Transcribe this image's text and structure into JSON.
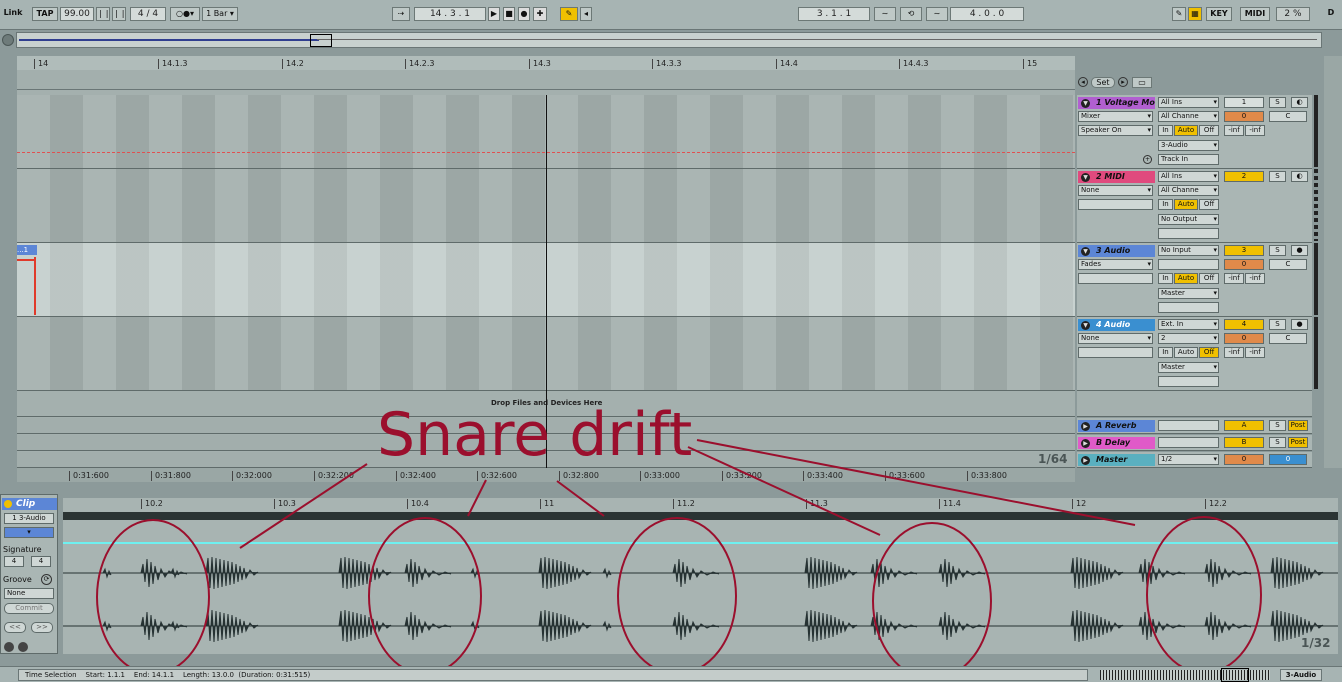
{
  "transport": {
    "link": "Link",
    "tap": "TAP",
    "tempo": "99.00",
    "sig_num": "4",
    "sig_sep": "/",
    "sig_den": "4",
    "quant": "1 Bar",
    "position": "14 . 3 . 1",
    "loop_start": "3 . 1 . 1",
    "loop_len": "4 . 0 . 0",
    "key": "KEY",
    "midi": "MIDI",
    "cpu": "2 %",
    "d": "D"
  },
  "arrangement": {
    "ruler_ticks": [
      "14",
      "14.1.3",
      "14.2",
      "14.2.3",
      "14.3",
      "14.3.3",
      "14.4",
      "14.4.3",
      "15"
    ],
    "time_ticks": [
      "0:31:600",
      "0:31:800",
      "0:32:000",
      "0:32:200",
      "0:32:400",
      "0:32:600",
      "0:32:800",
      "0:33:000",
      "0:33:200",
      "0:33:400",
      "0:33:600",
      "0:33:800"
    ],
    "drop_label": "Drop Files and Devices Here",
    "zoom": "1/64",
    "set_label": "Set",
    "clip_stub": "...1"
  },
  "tracks": [
    {
      "name": "1 Voltage Mo",
      "color": "#b15fd0",
      "input": "All Ins",
      "chan": "All Channe",
      "dev1": "Mixer",
      "dev2": "Speaker On",
      "out": "3-Audio",
      "out2": "Track In",
      "num": "1",
      "vol": "0",
      "pan": "C",
      "in": "In",
      "auto": "Auto",
      "off": "Off",
      "inf1": "-inf",
      "inf2": "-inf",
      "s": "S"
    },
    {
      "name": "2 MIDI",
      "color": "#e04a7e",
      "input": "All Ins",
      "chan": "All Channe",
      "dev1": "None",
      "out": "No Output",
      "num": "2",
      "in": "In",
      "auto": "Auto",
      "off": "Off",
      "s": "S"
    },
    {
      "name": "3 Audio",
      "color": "#5c86d6",
      "input": "No Input",
      "dev1": "Fades",
      "out": "Master",
      "num": "3",
      "vol": "0",
      "pan": "C",
      "in": "In",
      "auto": "Auto",
      "off": "Off",
      "inf1": "-inf",
      "inf2": "-inf",
      "s": "S"
    },
    {
      "name": "4 Audio",
      "color": "#3a8fd0",
      "input": "Ext. In",
      "chan": "2",
      "dev1": "None",
      "out": "Master",
      "num": "4",
      "vol": "0",
      "pan": "C",
      "in": "In",
      "auto": "Auto",
      "off": "Off",
      "inf1": "-inf",
      "inf2": "-inf",
      "s": "S"
    }
  ],
  "returns": [
    {
      "name": "A Reverb",
      "color": "#5c86d6",
      "num": "A",
      "s": "S",
      "post": "Post"
    },
    {
      "name": "B Delay",
      "color": "#e05ac8",
      "num": "B",
      "s": "S",
      "post": "Post"
    },
    {
      "name": "Master",
      "color": "#5ab0c0",
      "out": "1/2",
      "vol": "0",
      "pan": "0"
    }
  ],
  "clip": {
    "title": "Clip",
    "name": "1 3-Audio",
    "sig_label": "Signature",
    "sig_num": "4",
    "sig_den": "4",
    "groove_label": "Groove",
    "groove": "None",
    "commit": "Commit",
    "nav_prev": "<<",
    "nav_next": ">>",
    "ruler": [
      "10.2",
      "10.3",
      "10.4",
      "11",
      "11.2",
      "11.3",
      "11.4",
      "12",
      "12.2"
    ],
    "zoom": "1/32"
  },
  "status": {
    "text": "Time Selection    Start: 1.1.1    End: 14.1.1    Length: 13.0.0  (Duration: 0:31:515)",
    "track": "3-Audio"
  },
  "annotation": {
    "text": "Snare drift",
    "color": "#9b0f2d"
  }
}
